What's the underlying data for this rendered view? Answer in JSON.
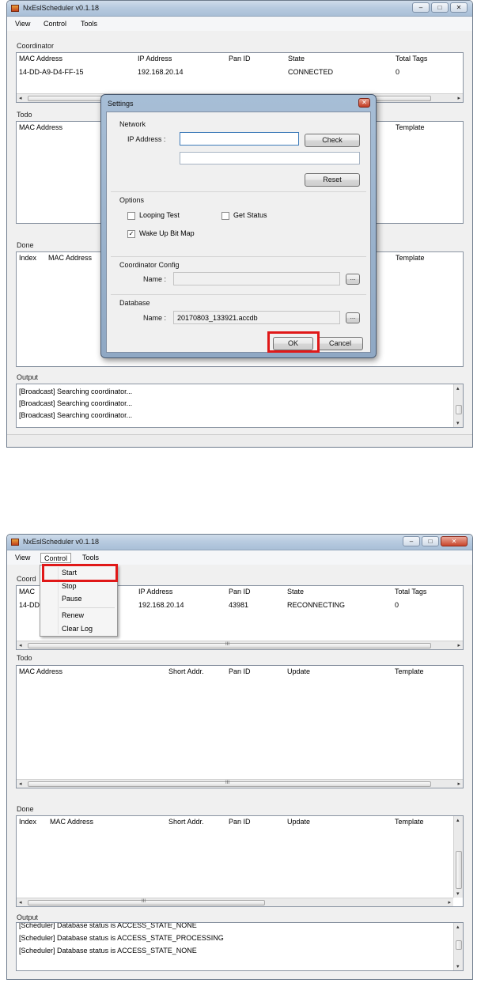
{
  "app": {
    "title": "NxEslScheduler v0.1.18",
    "window_buttons": {
      "minimize": "–",
      "maximize": "□",
      "close": "✕"
    }
  },
  "menu": [
    "View",
    "Control",
    "Tools"
  ],
  "top": {
    "coordinator": {
      "label": "Coordinator",
      "columns": [
        "MAC Address",
        "IP Address",
        "Pan ID",
        "State",
        "Total Tags"
      ],
      "row": [
        "14-DD-A9-D4-FF-15",
        "192.168.20.14",
        "",
        "CONNECTED",
        "0"
      ]
    },
    "todo": {
      "label": "Todo",
      "columns": [
        "MAC Address",
        "Template"
      ]
    },
    "done": {
      "label": "Done",
      "columns": [
        "Index",
        "MAC Address",
        "Template"
      ]
    },
    "output": {
      "label": "Output",
      "lines": [
        "[Broadcast] Searching coordinator...",
        "[Broadcast] Searching coordinator...",
        "[Broadcast] Searching coordinator..."
      ]
    },
    "settings": {
      "title": "Settings",
      "network_label": "Network",
      "ip_label": "IP Address :",
      "ip_value": "",
      "check_button": "Check",
      "reset_button": "Reset",
      "options_label": "Options",
      "looping_test": "Looping Test",
      "get_status": "Get Status",
      "wake_up_bit_map": "Wake Up Bit Map",
      "coordinator_config_label": "Coordinator Config",
      "name_label": "Name :",
      "coordinator_name_value": "",
      "database_label": "Database",
      "db_name_label": "Name :",
      "db_name_value": "20170803_133921.accdb",
      "browse_button": "...",
      "ok_button": "OK",
      "cancel_button": "Cancel",
      "looping_test_checked": false,
      "get_status_checked": false,
      "wake_up_bit_map_checked": true
    }
  },
  "bottom": {
    "control_menu": {
      "items": [
        "Start",
        "Stop",
        "Pause",
        "Renew",
        "Clear Log"
      ]
    },
    "coordinator": {
      "label": "Coord",
      "columns": [
        "MAC",
        "IP Address",
        "Pan ID",
        "State",
        "Total Tags"
      ],
      "row": [
        "14-DD",
        "192.168.20.14",
        "43981",
        "RECONNECTING",
        "0"
      ]
    },
    "todo": {
      "label": "Todo",
      "columns": [
        "MAC Address",
        "Short Addr.",
        "Pan ID",
        "Update",
        "Template"
      ]
    },
    "done": {
      "label": "Done",
      "columns": [
        "Index",
        "MAC Address",
        "Short Addr.",
        "Pan ID",
        "Update",
        "Template"
      ]
    },
    "output": {
      "label": "Output",
      "lines": [
        "[Scheduler] Database status is ACCESS_STATE_NONE",
        "[Scheduler] Database status is ACCESS_STATE_PROCESSING",
        "[Scheduler] Database status is ACCESS_STATE_NONE"
      ]
    }
  },
  "colors": {
    "highlight_box": "#e01818"
  }
}
